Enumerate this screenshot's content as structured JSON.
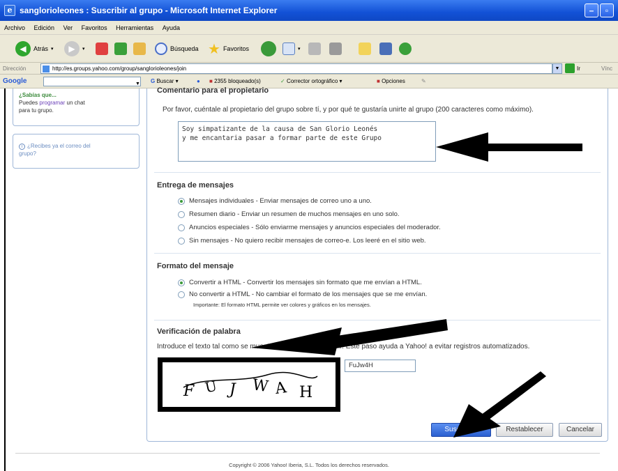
{
  "window": {
    "title": "sanglorioleones : Suscribir al grupo - Microsoft Internet Explorer",
    "icon": "ie-logo-icon"
  },
  "menubar": [
    "Archivo",
    "Edición",
    "Ver",
    "Favoritos",
    "Herramientas",
    "Ayuda"
  ],
  "toolbar": {
    "back_label": "Atrás",
    "search_label": "Búsqueda",
    "favorites_label": "Favoritos"
  },
  "address": {
    "label": "Dirección",
    "url": "http://es.groups.yahoo.com/group/sanglorioleones/join",
    "go_label": "Ir",
    "links_label": "Vínc"
  },
  "googlebar": {
    "logo": "Google",
    "search_label": "Buscar",
    "blocked_label": "2355 bloqueado(s)",
    "spell_label": "Corrector ortográfico",
    "options_label": "Opciones"
  },
  "sidebar": {
    "box1_title": "¿Sabías que...",
    "box1_text_pre": "Puedes",
    "box1_link": "programar",
    "box1_text_post": "un chat",
    "box1_text_line2": "para tu grupo.",
    "box2_link_line1": "¿Recibes ya el correo del",
    "box2_link_line2": "grupo?"
  },
  "comment": {
    "heading": "Comentario para el propietario",
    "instructions": "Por favor, cuéntale al propietario del grupo sobre tí, y por qué te gustaría unirte al grupo (200 caracteres como máximo).",
    "value": "Soy simpatizante de la causa de San Glorio Leonés\ny me encantaria pasar a formar parte de este Grupo"
  },
  "delivery": {
    "heading": "Entrega de mensajes",
    "options": [
      {
        "label": "Mensajes individuales - Enviar mensajes de correo uno a uno.",
        "selected": true
      },
      {
        "label": "Resumen diario - Enviar un resumen de muchos mensajes en uno solo.",
        "selected": false
      },
      {
        "label": "Anuncios especiales - Sólo enviarme mensajes y anuncios especiales del moderador.",
        "selected": false
      },
      {
        "label": "Sin mensajes - No quiero recibir mensajes de correo-e. Los leeré en el sitio web.",
        "selected": false
      }
    ]
  },
  "format": {
    "heading": "Formato del mensaje",
    "options": [
      {
        "label": "Convertir a HTML - Convertir los mensajes sin formato que me envían a HTML.",
        "selected": true
      },
      {
        "label": "No convertir a HTML - No cambiar el formato de los mensajes que se me envían.",
        "selected": false
      }
    ],
    "note": "Importante: El formato HTML permite ver colores y gráficos en los mensajes."
  },
  "verification": {
    "heading": "Verificación de palabra",
    "instructions": "Introduce el texto tal como se muestra en el cuadro a seguir. Este paso ayuda a Yahoo! a evitar registros automatizados.",
    "captcha_text": "FUJWAH",
    "input_value": "FuJw4H"
  },
  "buttons": {
    "submit": "Suscribirte",
    "reset": "Restablecer",
    "cancel": "Cancelar"
  },
  "footer": "Copyright © 2006 Yahoo! Iberia, S.L. Todos los derechos reservados.",
  "colors": {
    "titlebar": "#1251d6",
    "chrome": "#ece9d8",
    "panel_border": "#9fb7d8",
    "primary_button": "#2a5fd0",
    "radio_selected": "#3b9a3b"
  }
}
